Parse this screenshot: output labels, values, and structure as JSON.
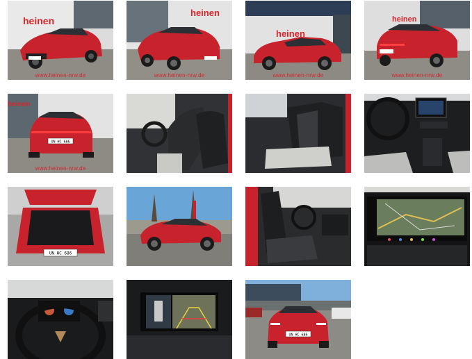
{
  "dealer": {
    "brand": "heinen",
    "url": "www.heinen-nrw.de"
  },
  "car": {
    "plate": "UN HC 686",
    "body_color": "#c8232c"
  },
  "thumbnails": [
    {
      "id": "t1",
      "kind": "exterior-front-left",
      "show_url": true
    },
    {
      "id": "t2",
      "kind": "exterior-front-left-2",
      "show_url": true
    },
    {
      "id": "t3",
      "kind": "exterior-side",
      "show_url": true
    },
    {
      "id": "t4",
      "kind": "exterior-rear-left",
      "show_url": true
    },
    {
      "id": "t5",
      "kind": "exterior-rear",
      "show_url": true
    },
    {
      "id": "t6",
      "kind": "interior-front-seats",
      "show_url": false
    },
    {
      "id": "t7",
      "kind": "interior-rear-seats",
      "show_url": false
    },
    {
      "id": "t8",
      "kind": "interior-dashboard",
      "show_url": false
    },
    {
      "id": "t9",
      "kind": "trunk-open",
      "show_url": false
    },
    {
      "id": "t10",
      "kind": "exterior-parking-lot",
      "show_url": false
    },
    {
      "id": "t11",
      "kind": "interior-door-view",
      "show_url": false
    },
    {
      "id": "t12",
      "kind": "navigation-screen",
      "show_url": false
    },
    {
      "id": "t13",
      "kind": "steering-wheel",
      "show_url": false
    },
    {
      "id": "t14",
      "kind": "reverse-camera-screen",
      "show_url": false
    },
    {
      "id": "t15",
      "kind": "exterior-front-lot",
      "show_url": false
    }
  ]
}
